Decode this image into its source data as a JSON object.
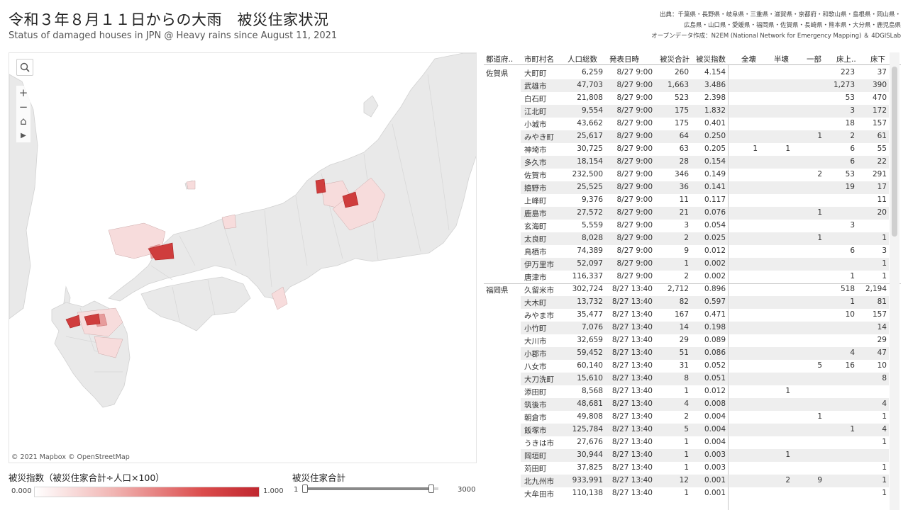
{
  "header": {
    "title_jp": "令和３年８月１１日からの大雨　被災住家状況",
    "title_en": "Status of damaged houses in JPN @ Heavy rains since August 11, 2021",
    "source_line1": "出典：千葉県・長野県・岐阜県・三重県・滋賀県・京都府・和歌山県・島根県・岡山県・",
    "source_line2": "広島県・山口県・愛媛県・福岡県・佐賀県・長崎県・熊本県・大分県・鹿児島県",
    "source_line3": "オープンデータ作成：N2EM (National Network for Emergency Mapping) ＆ 4DGISLab"
  },
  "map": {
    "attribution": "© 2021 Mapbox © OpenStreetMap",
    "tools": {
      "zoom_in": "+",
      "zoom_out": "−",
      "home": "⌂",
      "play": "▶"
    },
    "colors": {
      "sea": "#ffffff",
      "land": "#e9e9e9",
      "border": "#d0d0d0",
      "low": "#f6dede",
      "mid": "#e48a8a",
      "high": "#cc3b3b"
    }
  },
  "legend": {
    "color_title": "被災指数（被災住家合計÷人口×100）",
    "color_min": "0.000",
    "color_max": "1.000",
    "slider_title": "被災住家合計",
    "slider_min": "1",
    "slider_max": "3000",
    "slider_low_fraction": 0.0,
    "slider_high_fraction": 1.0
  },
  "table": {
    "headers": [
      "都道府..",
      "市町村名",
      "人口総数",
      "発表日時",
      "被災合計",
      "被災指数",
      "全壊",
      "半壊",
      "一部",
      "床上..",
      "床下"
    ],
    "groups": [
      {
        "pref": "佐賀県",
        "rows": [
          [
            "大町町",
            "6,259",
            "8/27 9:00",
            "260",
            "4.154",
            "",
            "",
            "",
            "223",
            "37"
          ],
          [
            "武雄市",
            "47,703",
            "8/27 9:00",
            "1,663",
            "3.486",
            "",
            "",
            "",
            "1,273",
            "390"
          ],
          [
            "白石町",
            "21,808",
            "8/27 9:00",
            "523",
            "2.398",
            "",
            "",
            "",
            "53",
            "470"
          ],
          [
            "江北町",
            "9,554",
            "8/27 9:00",
            "175",
            "1.832",
            "",
            "",
            "",
            "3",
            "172"
          ],
          [
            "小城市",
            "43,662",
            "8/27 9:00",
            "175",
            "0.401",
            "",
            "",
            "",
            "18",
            "157"
          ],
          [
            "みやき町",
            "25,617",
            "8/27 9:00",
            "64",
            "0.250",
            "",
            "",
            "1",
            "2",
            "61"
          ],
          [
            "神埼市",
            "30,725",
            "8/27 9:00",
            "63",
            "0.205",
            "1",
            "1",
            "",
            "6",
            "55"
          ],
          [
            "多久市",
            "18,154",
            "8/27 9:00",
            "28",
            "0.154",
            "",
            "",
            "",
            "6",
            "22"
          ],
          [
            "佐賀市",
            "232,500",
            "8/27 9:00",
            "346",
            "0.149",
            "",
            "",
            "2",
            "53",
            "291"
          ],
          [
            "嬉野市",
            "25,525",
            "8/27 9:00",
            "36",
            "0.141",
            "",
            "",
            "",
            "19",
            "17"
          ],
          [
            "上峰町",
            "9,376",
            "8/27 9:00",
            "11",
            "0.117",
            "",
            "",
            "",
            "",
            "11"
          ],
          [
            "鹿島市",
            "27,572",
            "8/27 9:00",
            "21",
            "0.076",
            "",
            "",
            "1",
            "",
            "20"
          ],
          [
            "玄海町",
            "5,559",
            "8/27 9:00",
            "3",
            "0.054",
            "",
            "",
            "",
            "3",
            ""
          ],
          [
            "太良町",
            "8,028",
            "8/27 9:00",
            "2",
            "0.025",
            "",
            "",
            "1",
            "",
            "1"
          ],
          [
            "鳥栖市",
            "74,389",
            "8/27 9:00",
            "9",
            "0.012",
            "",
            "",
            "",
            "6",
            "3"
          ],
          [
            "伊万里市",
            "52,097",
            "8/27 9:00",
            "1",
            "0.002",
            "",
            "",
            "",
            "",
            "1"
          ],
          [
            "唐津市",
            "116,337",
            "8/27 9:00",
            "2",
            "0.002",
            "",
            "",
            "",
            "1",
            "1"
          ]
        ]
      },
      {
        "pref": "福岡県",
        "rows": [
          [
            "久留米市",
            "302,724",
            "8/27 13:40",
            "2,712",
            "0.896",
            "",
            "",
            "",
            "518",
            "2,194"
          ],
          [
            "大木町",
            "13,732",
            "8/27 13:40",
            "82",
            "0.597",
            "",
            "",
            "",
            "1",
            "81"
          ],
          [
            "みやま市",
            "35,477",
            "8/27 13:40",
            "167",
            "0.471",
            "",
            "",
            "",
            "10",
            "157"
          ],
          [
            "小竹町",
            "7,076",
            "8/27 13:40",
            "14",
            "0.198",
            "",
            "",
            "",
            "",
            "14"
          ],
          [
            "大川市",
            "32,659",
            "8/27 13:40",
            "29",
            "0.089",
            "",
            "",
            "",
            "",
            "29"
          ],
          [
            "小郡市",
            "59,452",
            "8/27 13:40",
            "51",
            "0.086",
            "",
            "",
            "",
            "4",
            "47"
          ],
          [
            "八女市",
            "60,140",
            "8/27 13:40",
            "31",
            "0.052",
            "",
            "",
            "5",
            "16",
            "10"
          ],
          [
            "大刀洗町",
            "15,610",
            "8/27 13:40",
            "8",
            "0.051",
            "",
            "",
            "",
            "",
            "8"
          ],
          [
            "添田町",
            "8,568",
            "8/27 13:40",
            "1",
            "0.012",
            "",
            "1",
            "",
            "",
            ""
          ],
          [
            "筑後市",
            "48,681",
            "8/27 13:40",
            "4",
            "0.008",
            "",
            "",
            "",
            "",
            "4"
          ],
          [
            "朝倉市",
            "49,808",
            "8/27 13:40",
            "2",
            "0.004",
            "",
            "",
            "1",
            "",
            "1"
          ],
          [
            "飯塚市",
            "125,784",
            "8/27 13:40",
            "5",
            "0.004",
            "",
            "",
            "",
            "1",
            "4"
          ],
          [
            "うきは市",
            "27,676",
            "8/27 13:40",
            "1",
            "0.004",
            "",
            "",
            "",
            "",
            "1"
          ],
          [
            "岡垣町",
            "30,944",
            "8/27 13:40",
            "1",
            "0.003",
            "",
            "1",
            "",
            "",
            ""
          ],
          [
            "苅田町",
            "37,825",
            "8/27 13:40",
            "1",
            "0.003",
            "",
            "",
            "",
            "",
            "1"
          ],
          [
            "北九州市",
            "933,991",
            "8/27 13:40",
            "12",
            "0.001",
            "",
            "2",
            "9",
            "",
            "1"
          ],
          [
            "大牟田市",
            "110,138",
            "8/27 13:40",
            "1",
            "0.001",
            "",
            "",
            "",
            "",
            "1"
          ]
        ]
      }
    ]
  }
}
